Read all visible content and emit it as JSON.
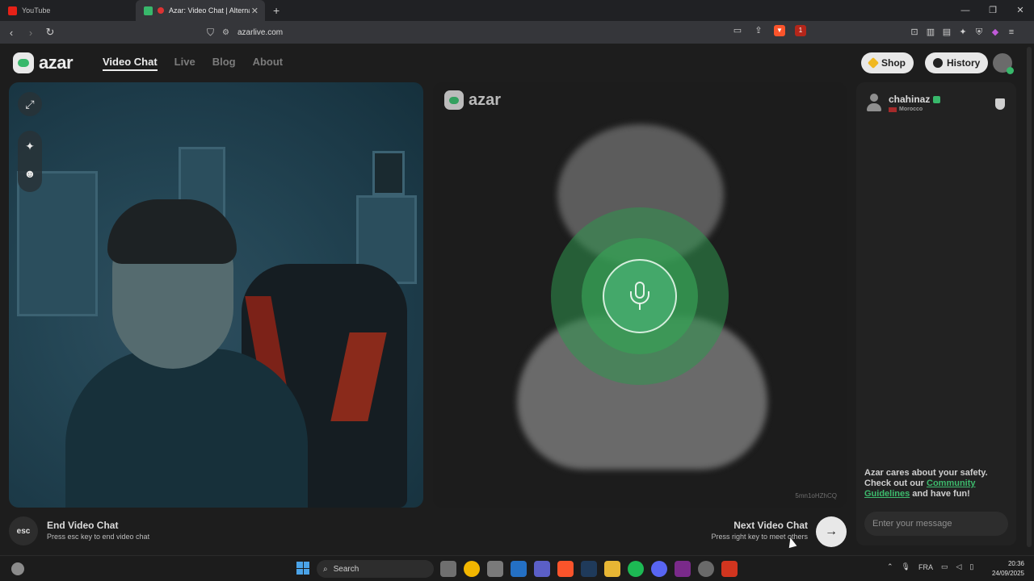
{
  "browser": {
    "tabs": [
      {
        "label": "YouTube",
        "active": false
      },
      {
        "label": "Azar: Video Chat | Alternative",
        "active": true
      }
    ],
    "url": "azarlive.com",
    "extension_badge": "1"
  },
  "app": {
    "logo_text": "azar",
    "nav": [
      "Video Chat",
      "Live",
      "Blog",
      "About"
    ],
    "active_nav": "Video Chat",
    "shop_label": "Shop",
    "history_label": "History",
    "colors": {
      "accent": "#38b86b",
      "background": "#1d1d1d",
      "panel": "#222222"
    }
  },
  "remote": {
    "logo_text": "azar",
    "status_icon": "microphone-icon",
    "session_id": "5mn1oHZhCQ"
  },
  "chat": {
    "peer_name": "chahinaz",
    "peer_country": "Morocco",
    "safety_line1": "Azar cares about your safety.",
    "safety_line2_prefix": "Check out our ",
    "safety_link": "Community Guidelines",
    "safety_line2_suffix": " and have fun!",
    "input_placeholder": "Enter your message"
  },
  "controls": {
    "esc_key": "esc",
    "end_title": "End Video Chat",
    "end_hint": "Press esc key to end video chat",
    "next_title": "Next Video Chat",
    "next_hint": "Press right key to meet others",
    "next_icon": "arrow-right-icon"
  },
  "taskbar": {
    "search_label": "Search",
    "language": "FRA",
    "time": "20:36",
    "date": "24/09/2025"
  }
}
